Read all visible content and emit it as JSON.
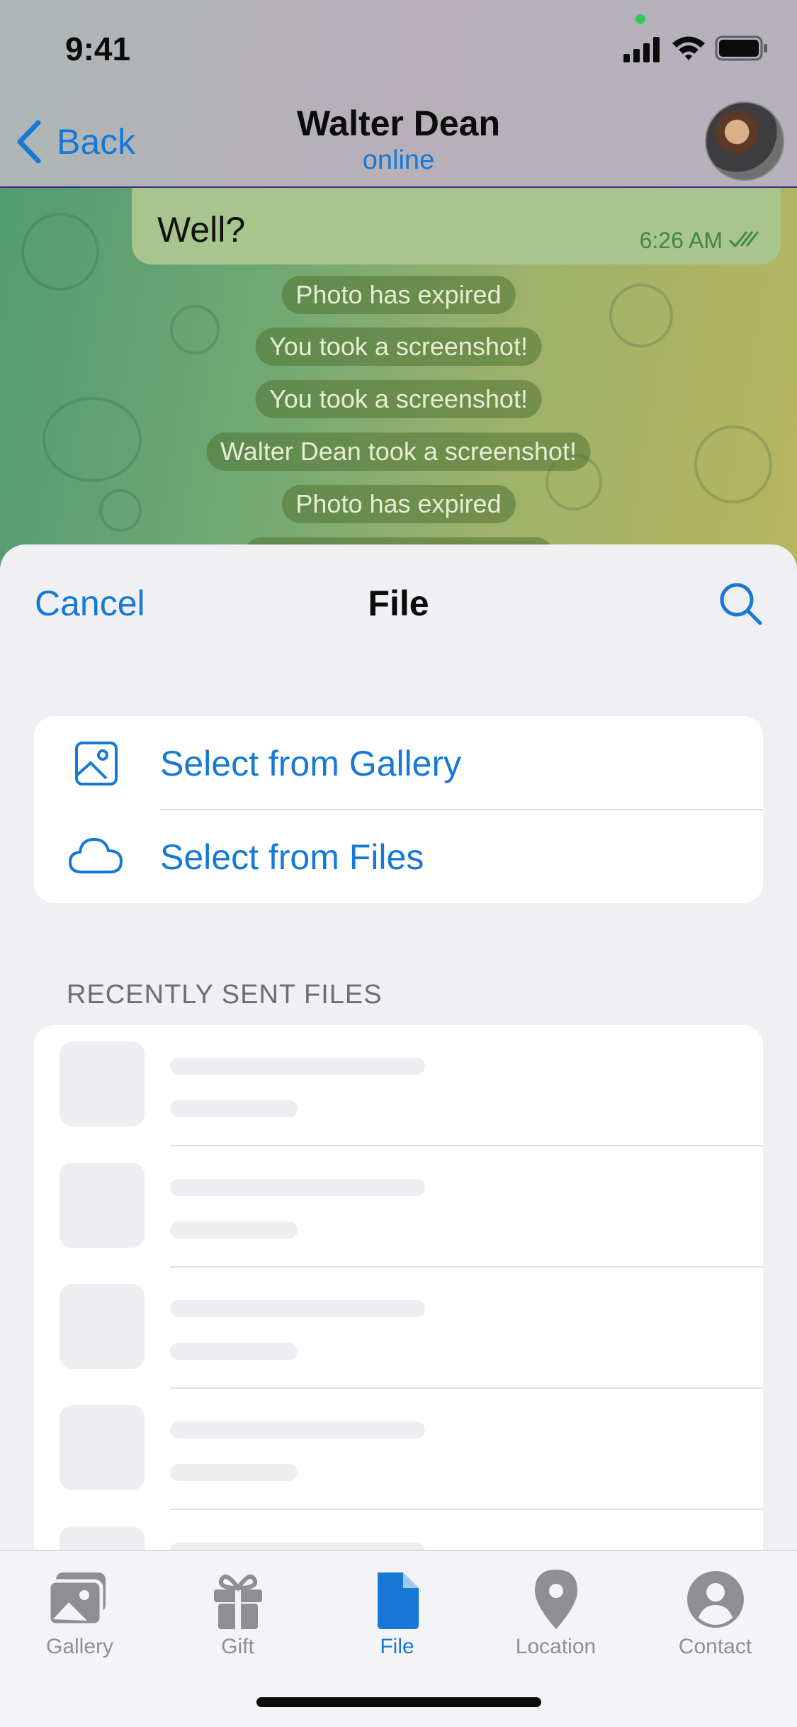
{
  "status_bar": {
    "time": "9:41"
  },
  "chat_header": {
    "back_label": "Back",
    "name": "Walter Dean",
    "status": "online"
  },
  "messages": {
    "bubble": {
      "text": "Well?",
      "time": "6:26 AM"
    },
    "service": [
      "Photo has expired",
      "You took a screenshot!",
      "You took a screenshot!",
      "Walter Dean took a screenshot!",
      "Photo has expired"
    ]
  },
  "sheet": {
    "cancel_label": "Cancel",
    "title": "File",
    "options": [
      {
        "label": "Select from Gallery",
        "icon": "gallery-icon"
      },
      {
        "label": "Select from Files",
        "icon": "cloud-icon"
      }
    ],
    "section_header": "RECENTLY SENT FILES"
  },
  "tabbar": {
    "tabs": [
      {
        "label": "Gallery",
        "icon": "gallery-tab-icon",
        "active": false
      },
      {
        "label": "Gift",
        "icon": "gift-icon",
        "active": false
      },
      {
        "label": "File",
        "icon": "file-icon",
        "active": true
      },
      {
        "label": "Location",
        "icon": "location-pin-icon",
        "active": false
      },
      {
        "label": "Contact",
        "icon": "contact-icon",
        "active": false
      }
    ]
  },
  "colors": {
    "accent": "#1679d6",
    "sheet_bg": "#efeff4",
    "bubble_bg": "#a7c58d",
    "tab_inactive": "#8e8e93"
  }
}
